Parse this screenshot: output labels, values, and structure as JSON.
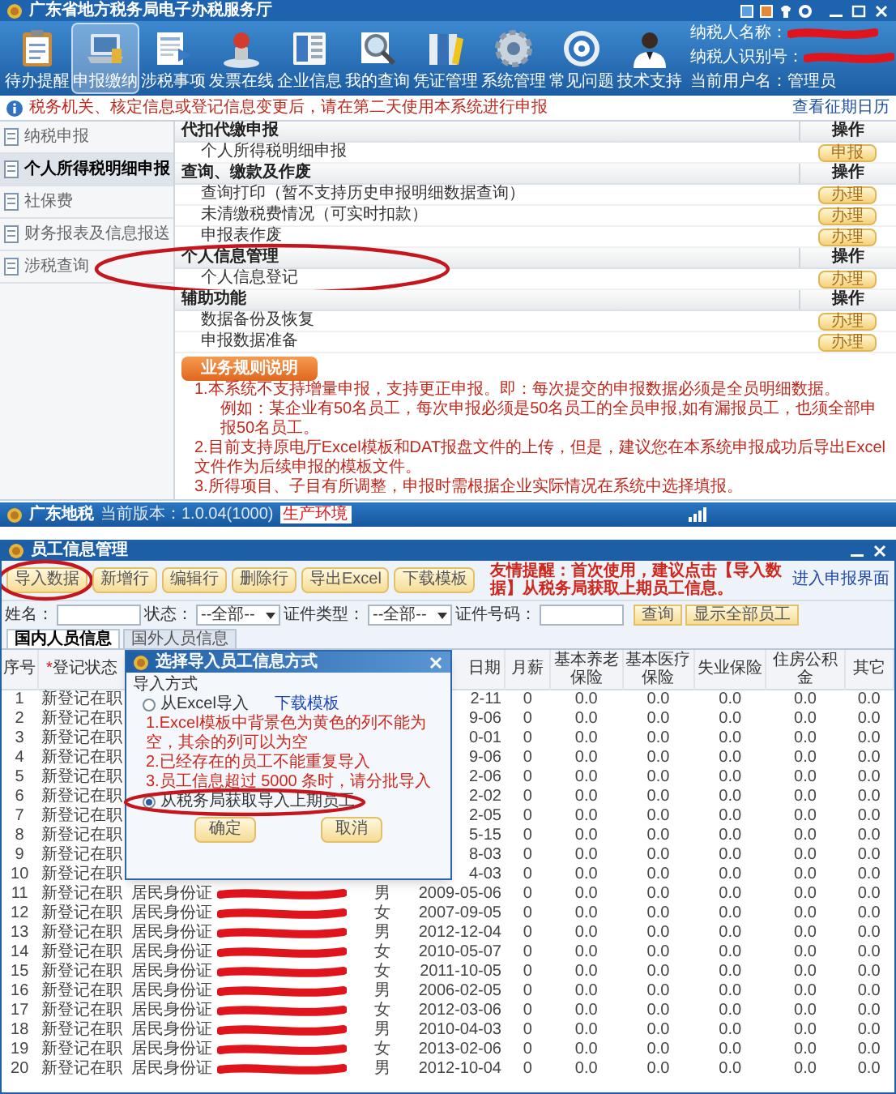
{
  "app_window": {
    "title": "广东省地方税务局电子办税服务厅"
  },
  "toolbar": [
    {
      "label": "待办提醒",
      "selected": false
    },
    {
      "label": "申报缴纳",
      "selected": true
    },
    {
      "label": "涉税事项",
      "selected": false
    },
    {
      "label": "发票在线",
      "selected": false
    },
    {
      "label": "企业信息",
      "selected": false
    },
    {
      "label": "我的查询",
      "selected": false
    },
    {
      "label": "凭证管理",
      "selected": false
    },
    {
      "label": "系统管理",
      "selected": false
    },
    {
      "label": "常见问题",
      "selected": false
    },
    {
      "label": "技术支持",
      "selected": false
    }
  ],
  "taxpayer": [
    {
      "label": "纳税人名称：",
      "redacted": true
    },
    {
      "label": "纳税人识别号：",
      "redacted": true
    },
    {
      "label": "当前用户名：",
      "value": "管理员"
    }
  ],
  "notice": {
    "text": "税务机关、核定信息或登记信息变更后，请在第二天使用本系统进行申报",
    "link": "查看征期日历"
  },
  "sidebar": [
    {
      "label": "纳税申报",
      "selected": false
    },
    {
      "label": "个人所得税明细申报",
      "selected": true
    },
    {
      "label": "社保费",
      "selected": false
    },
    {
      "label": "财务报表及信息报送",
      "selected": false
    },
    {
      "label": "涉税查询",
      "selected": false
    }
  ],
  "sections": [
    {
      "title": "代扣代缴申报",
      "action_header": "操作",
      "highlighted": false,
      "rows": [
        {
          "label": "个人所得税明细申报",
          "action": "申报"
        }
      ]
    },
    {
      "title": "查询、缴款及作废",
      "action_header": "操作",
      "highlighted": false,
      "rows": [
        {
          "label": "查询打印（暂不支持历史申报明细数据查询）",
          "action": "办理"
        },
        {
          "label": "未清缴税费情况（可实时扣款）",
          "action": "办理"
        },
        {
          "label": "申报表作废",
          "action": "办理"
        }
      ]
    },
    {
      "title": "个人信息管理",
      "action_header": "操作",
      "highlighted": true,
      "rows": [
        {
          "label": "个人信息登记",
          "action": "办理"
        }
      ]
    },
    {
      "title": "辅助功能",
      "action_header": "操作",
      "highlighted": false,
      "rows": [
        {
          "label": "数据备份及恢复",
          "action": "办理"
        },
        {
          "label": "申报数据准备",
          "action": "办理"
        }
      ]
    }
  ],
  "rules": {
    "button": "业务规则说明",
    "notes": [
      {
        "text": "1.本系统不支持增量申报，支持更正申报。即：每次提交的申报数据必须是全员明细数据。",
        "indent": false
      },
      {
        "text": "例如：某企业有50名员工，每次申报必须是50名员工的全员申报,如有漏报员工，也须全部申报50名员工。",
        "indent": true
      },
      {
        "text": "2.目前支持原电厅Excel模板和DAT报盘文件的上传，但是，建议您在本系统申报成功后导出Excel文件作为后续申报的模板文件。",
        "indent": false
      },
      {
        "text": "3.所得项目、子目有所调整，申报时需根据企业实际情况在系统中选择填报。",
        "indent": false
      }
    ]
  },
  "status_bar": {
    "app": "广东地税",
    "version": "当前版本：1.0.04(1000)",
    "environment": "生产环境"
  },
  "employee_window": {
    "title": "员工信息管理",
    "buttons": [
      {
        "label": "导入数据",
        "highlighted": true
      },
      {
        "label": "新增行",
        "highlighted": false
      },
      {
        "label": "编辑行",
        "highlighted": false
      },
      {
        "label": "删除行",
        "highlighted": false
      },
      {
        "label": "导出Excel",
        "highlighted": false
      },
      {
        "label": "下载模板",
        "highlighted": false
      }
    ],
    "reminder": "友情提醒：首次使用，建议点击【导入数据】从税务局获取上期员工信息。",
    "link": "进入申报界面",
    "filters": [
      {
        "kind": "text",
        "label": "姓名："
      },
      {
        "kind": "select",
        "label": "状态：",
        "value": "--全部--"
      },
      {
        "kind": "select",
        "label": "证件类型：",
        "value": "--全部--"
      },
      {
        "kind": "text",
        "label": "证件号码："
      }
    ],
    "filter_buttons": [
      "查询",
      "显示全部员工"
    ],
    "tabs": [
      {
        "label": "国内人员信息",
        "selected": true
      },
      {
        "label": "国外人员信息",
        "selected": false
      }
    ],
    "table": {
      "columns": [
        {
          "label": "序号"
        },
        {
          "label": "登记状态",
          "mark": "*"
        },
        {
          "label": "日期"
        },
        {
          "label": "月薪"
        },
        {
          "label": "基本养老保险"
        },
        {
          "label": "基本医疗保险"
        },
        {
          "label": "失业保险"
        },
        {
          "label": "住房公积金"
        },
        {
          "label": "其它"
        }
      ],
      "rows": [
        {
          "no": "1",
          "status": "新登记在职",
          "birth_date": "2-11",
          "salary": "0",
          "pension": "0.0",
          "medical": "0.0",
          "unemployment": "0.0",
          "housing_fund": "0.0",
          "other": "0.0"
        },
        {
          "no": "2",
          "status": "新登记在职",
          "birth_date": "9-06",
          "salary": "0",
          "pension": "0.0",
          "medical": "0.0",
          "unemployment": "0.0",
          "housing_fund": "0.0",
          "other": "0.0"
        },
        {
          "no": "3",
          "status": "新登记在职",
          "birth_date": "0-01",
          "salary": "0",
          "pension": "0.0",
          "medical": "0.0",
          "unemployment": "0.0",
          "housing_fund": "0.0",
          "other": "0.0"
        },
        {
          "no": "4",
          "status": "新登记在职",
          "birth_date": "9-06",
          "salary": "0",
          "pension": "0.0",
          "medical": "0.0",
          "unemployment": "0.0",
          "housing_fund": "0.0",
          "other": "0.0"
        },
        {
          "no": "5",
          "status": "新登记在职",
          "birth_date": "2-06",
          "salary": "0",
          "pension": "0.0",
          "medical": "0.0",
          "unemployment": "0.0",
          "housing_fund": "0.0",
          "other": "0.0"
        },
        {
          "no": "6",
          "status": "新登记在职",
          "birth_date": "2-02",
          "salary": "0",
          "pension": "0.0",
          "medical": "0.0",
          "unemployment": "0.0",
          "housing_fund": "0.0",
          "other": "0.0"
        },
        {
          "no": "7",
          "status": "新登记在职",
          "birth_date": "2-05",
          "salary": "0",
          "pension": "0.0",
          "medical": "0.0",
          "unemployment": "0.0",
          "housing_fund": "0.0",
          "other": "0.0"
        },
        {
          "no": "8",
          "status": "新登记在职",
          "birth_date": "5-15",
          "salary": "0",
          "pension": "0.0",
          "medical": "0.0",
          "unemployment": "0.0",
          "housing_fund": "0.0",
          "other": "0.0"
        },
        {
          "no": "9",
          "status": "新登记在职",
          "birth_date": "8-03",
          "salary": "0",
          "pension": "0.0",
          "medical": "0.0",
          "unemployment": "0.0",
          "housing_fund": "0.0",
          "other": "0.0"
        },
        {
          "no": "10",
          "status": "新登记在职",
          "birth_date": "4-03",
          "salary": "0",
          "pension": "0.0",
          "medical": "0.0",
          "unemployment": "0.0",
          "housing_fund": "0.0",
          "other": "0.0"
        },
        {
          "no": "11",
          "status": "新登记在职",
          "id_type": "居民身份证",
          "id_redacted": true,
          "gender": "男",
          "birth_date": "2009-05-06",
          "salary": "0",
          "pension": "0.0",
          "medical": "0.0",
          "unemployment": "0.0",
          "housing_fund": "0.0",
          "other": "0.0"
        },
        {
          "no": "12",
          "status": "新登记在职",
          "id_type": "居民身份证",
          "id_redacted": true,
          "gender": "女",
          "birth_date": "2007-09-05",
          "salary": "0",
          "pension": "0.0",
          "medical": "0.0",
          "unemployment": "0.0",
          "housing_fund": "0.0",
          "other": "0.0"
        },
        {
          "no": "13",
          "status": "新登记在职",
          "id_type": "居民身份证",
          "id_redacted": true,
          "gender": "男",
          "birth_date": "2012-12-04",
          "salary": "0",
          "pension": "0.0",
          "medical": "0.0",
          "unemployment": "0.0",
          "housing_fund": "0.0",
          "other": "0.0"
        },
        {
          "no": "14",
          "status": "新登记在职",
          "id_type": "居民身份证",
          "id_redacted": true,
          "gender": "女",
          "birth_date": "2010-05-07",
          "salary": "0",
          "pension": "0.0",
          "medical": "0.0",
          "unemployment": "0.0",
          "housing_fund": "0.0",
          "other": "0.0"
        },
        {
          "no": "15",
          "status": "新登记在职",
          "id_type": "居民身份证",
          "id_redacted": true,
          "gender": "女",
          "birth_date": "2011-10-05",
          "salary": "0",
          "pension": "0.0",
          "medical": "0.0",
          "unemployment": "0.0",
          "housing_fund": "0.0",
          "other": "0.0"
        },
        {
          "no": "16",
          "status": "新登记在职",
          "id_type": "居民身份证",
          "id_redacted": true,
          "gender": "男",
          "birth_date": "2006-02-05",
          "salary": "0",
          "pension": "0.0",
          "medical": "0.0",
          "unemployment": "0.0",
          "housing_fund": "0.0",
          "other": "0.0"
        },
        {
          "no": "17",
          "status": "新登记在职",
          "id_type": "居民身份证",
          "id_redacted": true,
          "gender": "女",
          "birth_date": "2012-03-06",
          "salary": "0",
          "pension": "0.0",
          "medical": "0.0",
          "unemployment": "0.0",
          "housing_fund": "0.0",
          "other": "0.0"
        },
        {
          "no": "18",
          "status": "新登记在职",
          "id_type": "居民身份证",
          "id_redacted": true,
          "gender": "男",
          "birth_date": "2010-04-03",
          "salary": "0",
          "pension": "0.0",
          "medical": "0.0",
          "unemployment": "0.0",
          "housing_fund": "0.0",
          "other": "0.0"
        },
        {
          "no": "19",
          "status": "新登记在职",
          "id_type": "居民身份证",
          "id_redacted": true,
          "gender": "女",
          "birth_date": "2013-02-06",
          "salary": "0",
          "pension": "0.0",
          "medical": "0.0",
          "unemployment": "0.0",
          "housing_fund": "0.0",
          "other": "0.0"
        },
        {
          "no": "20",
          "status": "新登记在职",
          "id_type": "居民身份证",
          "id_redacted": true,
          "gender": "男",
          "birth_date": "2012-10-04",
          "salary": "0",
          "pension": "0.0",
          "medical": "0.0",
          "unemployment": "0.0",
          "housing_fund": "0.0",
          "other": "0.0"
        }
      ]
    }
  },
  "dialog": {
    "title": "选择导入员工信息方式",
    "group_label": "导入方式",
    "options": [
      {
        "label": "从Excel导入",
        "selected": false,
        "highlighted": false,
        "link": "下载模板",
        "notes": [
          "1.Excel模板中背景色为黄色的列不能为空，其余的列可以为空",
          "2.已经存在的员工不能重复导入",
          "3.员工信息超过 5000 条时，请分批导入"
        ]
      },
      {
        "label": "从税务局获取导入上期员工",
        "selected": true,
        "highlighted": true
      }
    ],
    "buttons": [
      "确定",
      "取消"
    ]
  }
}
